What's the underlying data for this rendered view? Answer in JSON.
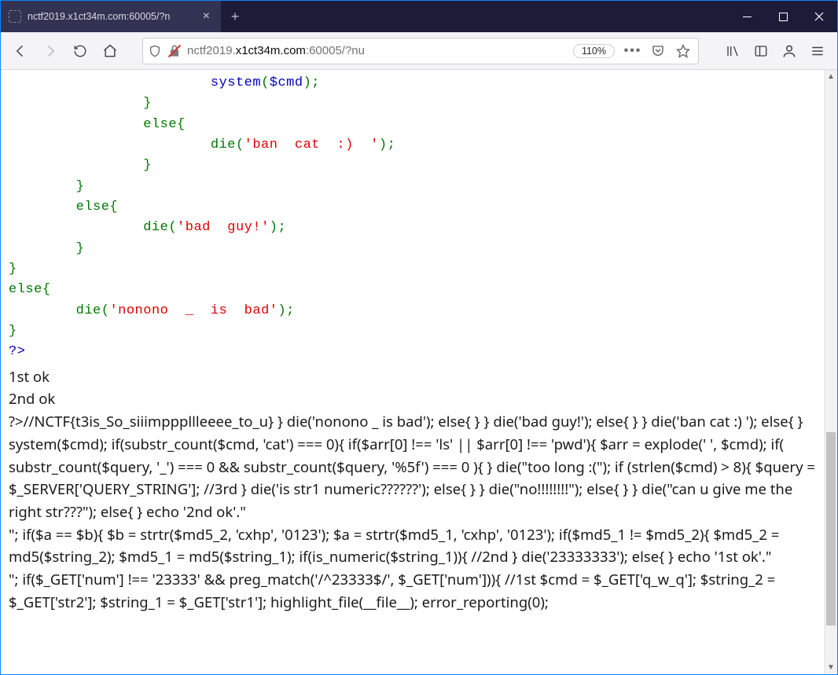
{
  "window": {
    "tab_title": "nctf2019.x1ct34m.com:60005/?n",
    "url_prefix": "nctf2019.",
    "url_host": "x1ct34m.com",
    "url_suffix": ":60005/?nu",
    "zoom": "110%"
  },
  "code": {
    "l1_indent": "                        ",
    "l1_a": "system",
    "l1_b": "(",
    "l1_c": "$cmd",
    "l1_d": ");",
    "l2": "                }",
    "l3a": "                else",
    "l3b": "{",
    "l4_indent": "                        ",
    "l4_a": "die",
    "l4_b": "(",
    "l4_c": "'ban  cat  :)  '",
    "l4_d": ");",
    "l5": "                }",
    "l6": "        }",
    "l7a": "        else",
    "l7b": "{",
    "l8_indent": "                ",
    "l8_a": "die",
    "l8_b": "(",
    "l8_c": "'bad  guy!'",
    "l8_d": ");",
    "l9": "        }",
    "l10": "}",
    "l11a": "else",
    "l11b": "{",
    "l12_indent": "        ",
    "l12_a": "die",
    "l12_b": "(",
    "l12_c": "'nonono  _  is  bad'",
    "l12_d": ");",
    "l13": "}",
    "l14": "?>"
  },
  "out": {
    "ok1": "1st ok",
    "ok2": "2nd ok",
    "body": "?>//NCTF{t3is_So_siiimpppllleeee_to_u} } die('nonono _ is bad'); else{ } } die('bad guy!'); else{ } } die('ban cat :) '); else{ } system($cmd); if(substr_count($cmd, 'cat') === 0){ if($arr[0] !== 'ls' || $arr[0] !== 'pwd'){ $arr = explode(' ', $cmd); if( substr_count($query, '_') === 0 && substr_count($query, '%5f') === 0 ){ } die(\"too long :(\"); if (strlen($cmd) > 8){ $query = $_SERVER['QUERY_STRING']; //3rd } die('is str1 numeric??????'); else{ } } die(\"no!!!!!!!!\"); else{ } } die(\"can u give me the right str???\"); else{ } echo '2nd ok'.\"",
    "body2": "\"; if($a == $b){ $b = strtr($md5_2, 'cxhp', '0123'); $a = strtr($md5_1, 'cxhp', '0123'); if($md5_1 != $md5_2){ $md5_2 = md5($string_2); $md5_1 = md5($string_1); if(is_numeric($string_1)){ //2nd } die('23333333'); else{ } echo '1st ok'.\"",
    "body3": "\"; if($_GET['num'] !== '23333' && preg_match('/^23333$/', $_GET['num'])){ //1st $cmd = $_GET['q_w_q']; $string_2 = $_GET['str2']; $string_1 = $_GET['str1']; highlight_file(__file__); error_reporting(0);"
  }
}
